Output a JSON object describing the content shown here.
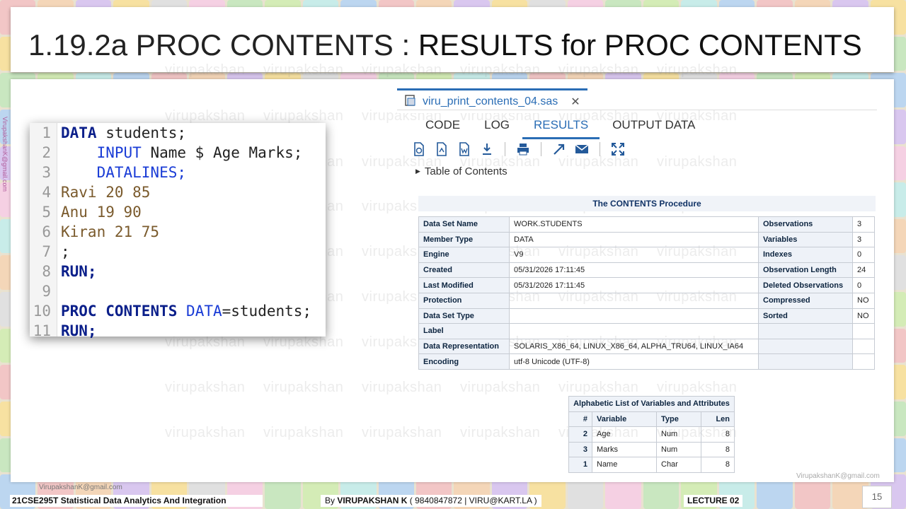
{
  "slide": {
    "title_prefix": "1.19.2a PROC CONTENTS : ",
    "title_main": "RESULTS for PROC CONTENTS",
    "watermark": "virupakshan",
    "side_email": "VirupakshanK@gmail.com"
  },
  "code": {
    "lines": [
      {
        "n": "1"
      },
      {
        "n": "2"
      },
      {
        "n": "3"
      },
      {
        "n": "4"
      },
      {
        "n": "5"
      },
      {
        "n": "6"
      },
      {
        "n": "7"
      },
      {
        "n": "8"
      },
      {
        "n": "9"
      },
      {
        "n": "10"
      },
      {
        "n": "11"
      }
    ],
    "t": {
      "data": "DATA",
      "students": " students;",
      "input": "INPUT",
      "input_rest": " Name $ Age Marks;",
      "datalines": "DATALINES;",
      "row1": "Ravi 20 85",
      "row2": "Anu 19 90",
      "row3": "Kiran 21 75",
      "semi": ";",
      "run": "RUN;",
      "proc": "PROC",
      "contents": "CONTENTS",
      "data_opt": "DATA",
      "eq_students": "=students;",
      "run2": "RUN;"
    }
  },
  "sas": {
    "file_tab": "viru_print_contents_04.sas",
    "close": "✕",
    "subtabs": [
      "CODE",
      "LOG",
      "RESULTS",
      "OUTPUT DATA"
    ],
    "active_subtab": "RESULTS",
    "toolbar_icons": [
      "html-icon",
      "pdf-icon",
      "rtf-icon",
      "download-icon",
      "print-icon",
      "new-window-icon",
      "email-icon",
      "maximize-icon"
    ],
    "toc": "Table of Contents",
    "proc_title": "The CONTENTS Procedure",
    "attributes": [
      [
        "Data Set Name",
        "WORK.STUDENTS",
        "Observations",
        "3"
      ],
      [
        "Member Type",
        "DATA",
        "Variables",
        "3"
      ],
      [
        "Engine",
        "V9",
        "Indexes",
        "0"
      ],
      [
        "Created",
        "05/31/2026 17:11:45",
        "Observation Length",
        "24"
      ],
      [
        "Last Modified",
        "05/31/2026 17:11:45",
        "Deleted Observations",
        "0"
      ],
      [
        "Protection",
        "",
        "Compressed",
        "NO"
      ],
      [
        "Data Set Type",
        "",
        "Sorted",
        "NO"
      ],
      [
        "Label",
        "",
        "",
        ""
      ],
      [
        "Data Representation",
        "SOLARIS_X86_64, LINUX_X86_64, ALPHA_TRU64, LINUX_IA64",
        "",
        ""
      ],
      [
        "Encoding",
        "utf-8 Unicode (UTF-8)",
        "",
        ""
      ]
    ],
    "vars_caption": "Alphabetic List of Variables and Attributes",
    "vars_headers": [
      "#",
      "Variable",
      "Type",
      "Len"
    ],
    "vars_rows": [
      [
        "2",
        "Age",
        "Num",
        "8"
      ],
      [
        "3",
        "Marks",
        "Num",
        "8"
      ],
      [
        "1",
        "Name",
        "Char",
        "8"
      ]
    ]
  },
  "footer": {
    "email": "VirupakshanK@gmail.com",
    "course": "21CSE295T Statistical Data Analytics And Integration",
    "by_prefix": "By ",
    "author": "VIRUPAKSHAN K",
    "contact": " ( 9840847872 | VIRU@KART.LA )",
    "lecture": "LECTURE 02",
    "page": "15"
  },
  "colors": {
    "accent": "#2a6db5",
    "keyword": "#0b1f8a",
    "data_text": "#7a5a2c"
  }
}
